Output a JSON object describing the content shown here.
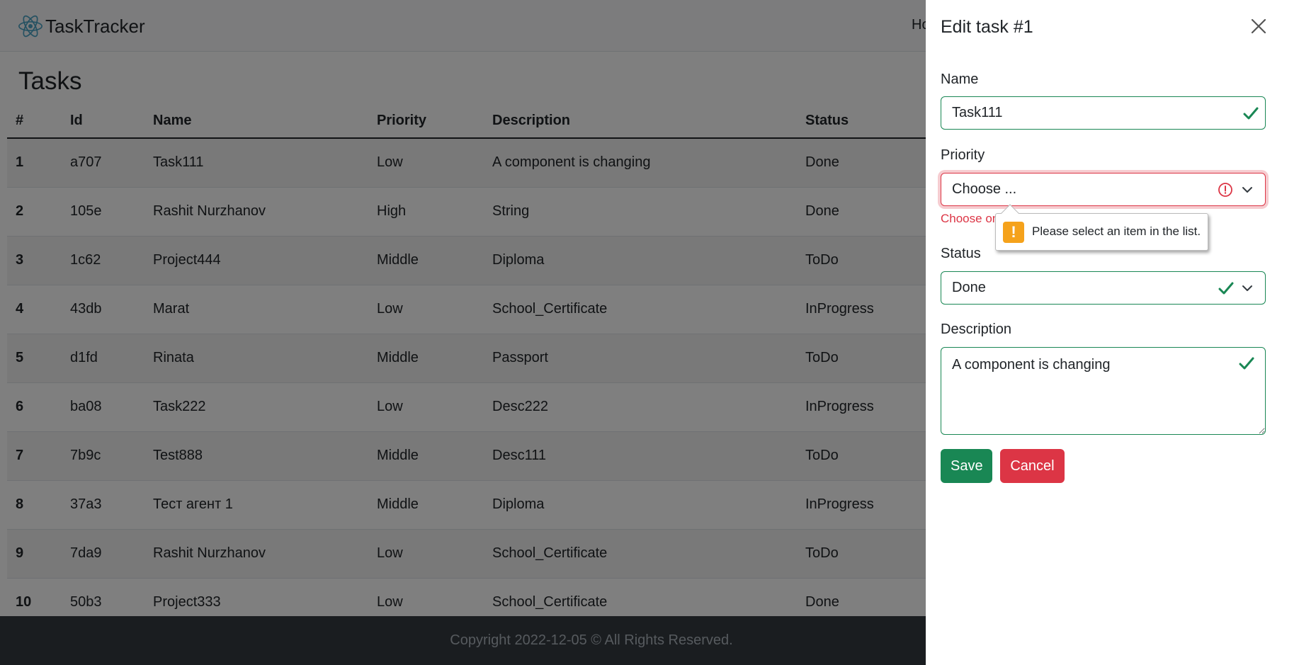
{
  "navbar": {
    "brand": "TaskTracker",
    "home_link": "Ho"
  },
  "page": {
    "title": "Tasks"
  },
  "table": {
    "headers": [
      "#",
      "Id",
      "Name",
      "Priority",
      "Description",
      "Status"
    ],
    "rows": [
      [
        "1",
        "a707",
        "Task111",
        "Low",
        "A component is changing",
        "Done"
      ],
      [
        "2",
        "105e",
        "Rashit Nurzhanov",
        "High",
        "String",
        "Done"
      ],
      [
        "3",
        "1c62",
        "Project444",
        "Middle",
        "Diploma",
        "ToDo"
      ],
      [
        "4",
        "43db",
        "Marat",
        "Low",
        "School_Certificate",
        "InProgress"
      ],
      [
        "5",
        "d1fd",
        "Rinata",
        "Middle",
        "Passport",
        "ToDo"
      ],
      [
        "6",
        "ba08",
        "Task222",
        "Low",
        "Desc222",
        "InProgress"
      ],
      [
        "7",
        "7b9c",
        "Test888",
        "Middle",
        "Desc111",
        "ToDo"
      ],
      [
        "8",
        "37a3",
        "Тест агент 1",
        "Middle",
        "Diploma",
        "InProgress"
      ],
      [
        "9",
        "7da9",
        "Rashit Nurzhanov",
        "Low",
        "School_Certificate",
        "ToDo"
      ],
      [
        "10",
        "50b3",
        "Project333",
        "Low",
        "School_Certificate",
        "Done"
      ]
    ]
  },
  "footer": {
    "text": "Copyright 2022-12-05 © All Rights Reserved."
  },
  "edit_panel": {
    "title": "Edit task #1",
    "name_label": "Name",
    "name_value": "Task111",
    "priority_label": "Priority",
    "priority_value": "Choose ...",
    "priority_feedback": "Choose on",
    "validation_tooltip": "Please select an item in the list.",
    "status_label": "Status",
    "status_value": "Done",
    "description_label": "Description",
    "description_value": "A component is changing",
    "save_label": "Save",
    "cancel_label": "Cancel"
  },
  "colors": {
    "valid": "#198754",
    "invalid": "#dc3545",
    "warning": "#f5a21b",
    "footer_bg": "#343a40"
  }
}
